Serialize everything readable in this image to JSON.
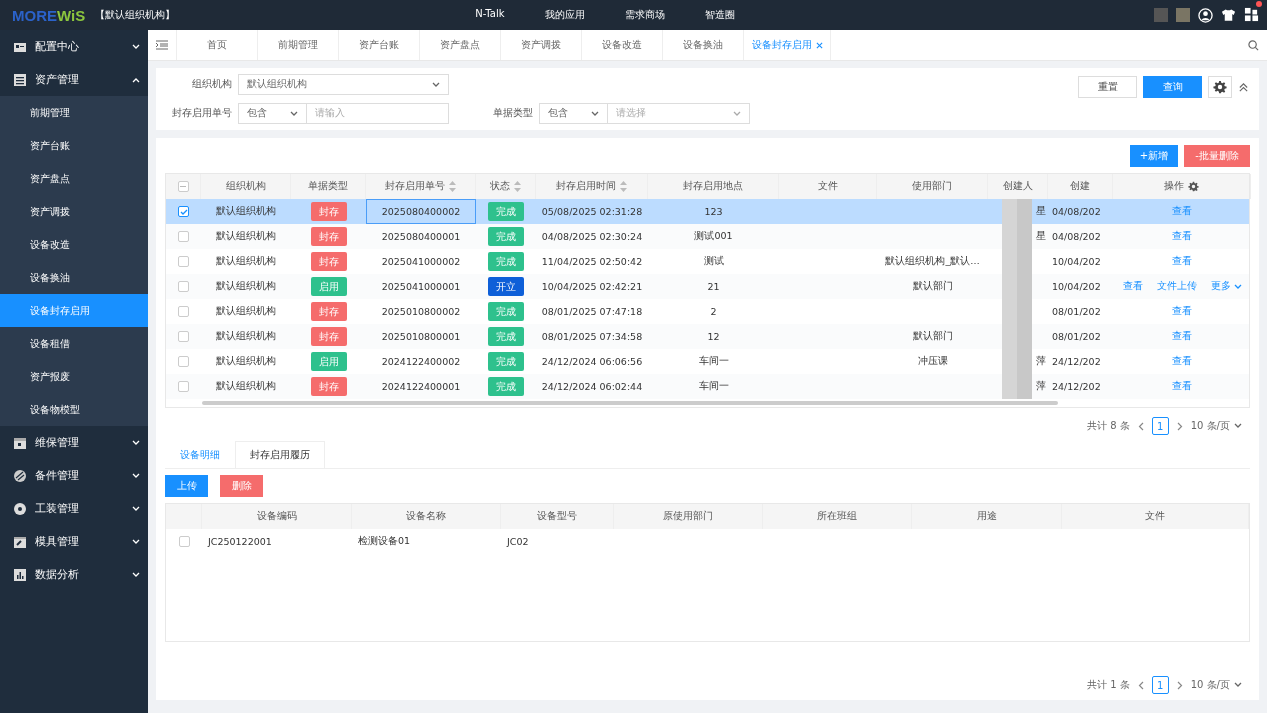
{
  "header": {
    "logo_a": "MORE",
    "logo_b": "WiS",
    "org": "【默认组织机构】",
    "nav": [
      "N-Talk",
      "我的应用",
      "需求商场",
      "智造圈"
    ],
    "notification": true
  },
  "sidebar": {
    "items": [
      {
        "label": "配置中心",
        "expanded": false
      },
      {
        "label": "资产管理",
        "expanded": true,
        "children": [
          {
            "label": "前期管理",
            "selected": false
          },
          {
            "label": "资产台账",
            "selected": false
          },
          {
            "label": "资产盘点",
            "selected": false
          },
          {
            "label": "资产调拨",
            "selected": false
          },
          {
            "label": "设备改造",
            "selected": false
          },
          {
            "label": "设备换油",
            "selected": false
          },
          {
            "label": "设备封存启用",
            "selected": true
          },
          {
            "label": "设备租借",
            "selected": false
          },
          {
            "label": "资产报废",
            "selected": false
          },
          {
            "label": "设备物模型",
            "selected": false
          }
        ]
      },
      {
        "label": "维保管理",
        "expanded": false
      },
      {
        "label": "备件管理",
        "expanded": false
      },
      {
        "label": "工装管理",
        "expanded": false
      },
      {
        "label": "模具管理",
        "expanded": false
      },
      {
        "label": "数据分析",
        "expanded": false
      }
    ]
  },
  "tabs": [
    {
      "label": "首页",
      "selected": false
    },
    {
      "label": "前期管理",
      "selected": false
    },
    {
      "label": "资产台账",
      "selected": false
    },
    {
      "label": "资产盘点",
      "selected": false
    },
    {
      "label": "资产调拨",
      "selected": false
    },
    {
      "label": "设备改造",
      "selected": false
    },
    {
      "label": "设备换油",
      "selected": false
    },
    {
      "label": "设备封存启用",
      "selected": true,
      "closable": true
    }
  ],
  "filter": {
    "org_label": "组织机构",
    "org_value": "默认组织机构",
    "no_label": "封存启用单号",
    "no_op": "包含",
    "no_placeholder": "请输入",
    "type_label": "单据类型",
    "type_op": "包含",
    "type_placeholder": "请选择",
    "reset": "重置",
    "query": "查询"
  },
  "actions": {
    "add": "+新增",
    "batch_delete": "-批量删除"
  },
  "table": {
    "select_all_partial": true,
    "columns": [
      {
        "label": "组织机构"
      },
      {
        "label": "单据类型"
      },
      {
        "label": "封存启用单号",
        "sortable": true
      },
      {
        "label": "状态",
        "sortable": true
      },
      {
        "label": "封存启用时间",
        "sortable": true
      },
      {
        "label": "封存启用地点"
      },
      {
        "label": "文件"
      },
      {
        "label": "使用部门"
      },
      {
        "label": "创建人"
      },
      {
        "label": "创建"
      },
      {
        "label": "操作"
      }
    ],
    "rows": [
      {
        "selected": true,
        "org": "默认组织机构",
        "type": {
          "text": "封存",
          "kind": "seal"
        },
        "no": "2025080400002",
        "status": {
          "text": "完成",
          "kind": "done"
        },
        "time": "05/08/2025 02:31:28",
        "place": "123",
        "creator": "星",
        "created": "04/08/202",
        "ops": [
          "查看"
        ]
      },
      {
        "selected": false,
        "org": "默认组织机构",
        "type": {
          "text": "封存",
          "kind": "seal"
        },
        "no": "2025080400001",
        "status": {
          "text": "完成",
          "kind": "done"
        },
        "time": "04/08/2025 02:30:24",
        "place": "测试001",
        "creator": "星",
        "created": "04/08/202",
        "ops": [
          "查看"
        ]
      },
      {
        "selected": false,
        "org": "默认组织机构",
        "type": {
          "text": "封存",
          "kind": "seal"
        },
        "no": "2025041000002",
        "status": {
          "text": "完成",
          "kind": "done"
        },
        "time": "11/04/2025 02:50:42",
        "place": "测试",
        "dept": "默认组织机构_默认…",
        "created": "10/04/202",
        "ops": [
          "查看"
        ]
      },
      {
        "selected": false,
        "org": "默认组织机构",
        "type": {
          "text": "启用",
          "kind": "enable"
        },
        "no": "2025041000001",
        "status": {
          "text": "开立",
          "kind": "open"
        },
        "time": "10/04/2025 02:42:21",
        "place": "21",
        "dept": "默认部门",
        "created": "10/04/202",
        "ops": [
          "查看",
          "文件上传",
          "更多"
        ]
      },
      {
        "selected": false,
        "org": "默认组织机构",
        "type": {
          "text": "封存",
          "kind": "seal"
        },
        "no": "2025010800002",
        "status": {
          "text": "完成",
          "kind": "done"
        },
        "time": "08/01/2025 07:47:18",
        "place": "2",
        "created": "08/01/202",
        "ops": [
          "查看"
        ]
      },
      {
        "selected": false,
        "org": "默认组织机构",
        "type": {
          "text": "封存",
          "kind": "seal"
        },
        "no": "2025010800001",
        "status": {
          "text": "完成",
          "kind": "done"
        },
        "time": "08/01/2025 07:34:58",
        "place": "12",
        "dept": "默认部门",
        "created": "08/01/202",
        "ops": [
          "查看"
        ]
      },
      {
        "selected": false,
        "org": "默认组织机构",
        "type": {
          "text": "启用",
          "kind": "enable"
        },
        "no": "2024122400002",
        "status": {
          "text": "完成",
          "kind": "done"
        },
        "time": "24/12/2024 06:06:56",
        "place": "车间一",
        "dept": "冲压课",
        "creator": "萍",
        "created": "24/12/202",
        "ops": [
          "查看"
        ]
      },
      {
        "selected": false,
        "org": "默认组织机构",
        "type": {
          "text": "封存",
          "kind": "seal"
        },
        "no": "2024122400001",
        "status": {
          "text": "完成",
          "kind": "done"
        },
        "time": "24/12/2024 06:02:44",
        "place": "车间一",
        "creator": "萍",
        "created": "24/12/202",
        "ops": [
          "查看"
        ]
      }
    ]
  },
  "pagination": {
    "total": "共计 8 条",
    "page": "1",
    "size": "10 条/页"
  },
  "detail": {
    "tabs": [
      {
        "label": "设备明细",
        "selected": true
      },
      {
        "label": "封存启用履历",
        "selected": false
      }
    ],
    "upload": "上传",
    "delete": "删除",
    "columns": [
      "设备编码",
      "设备名称",
      "设备型号",
      "原使用部门",
      "所在班组",
      "用途",
      "文件"
    ],
    "rows": [
      {
        "selected": false,
        "cells": [
          "JC250122001",
          "检测设备01",
          "JC02"
        ]
      }
    ]
  },
  "detail_pagination": {
    "total": "共计 1 条",
    "page": "1",
    "size": "10 条/页"
  }
}
